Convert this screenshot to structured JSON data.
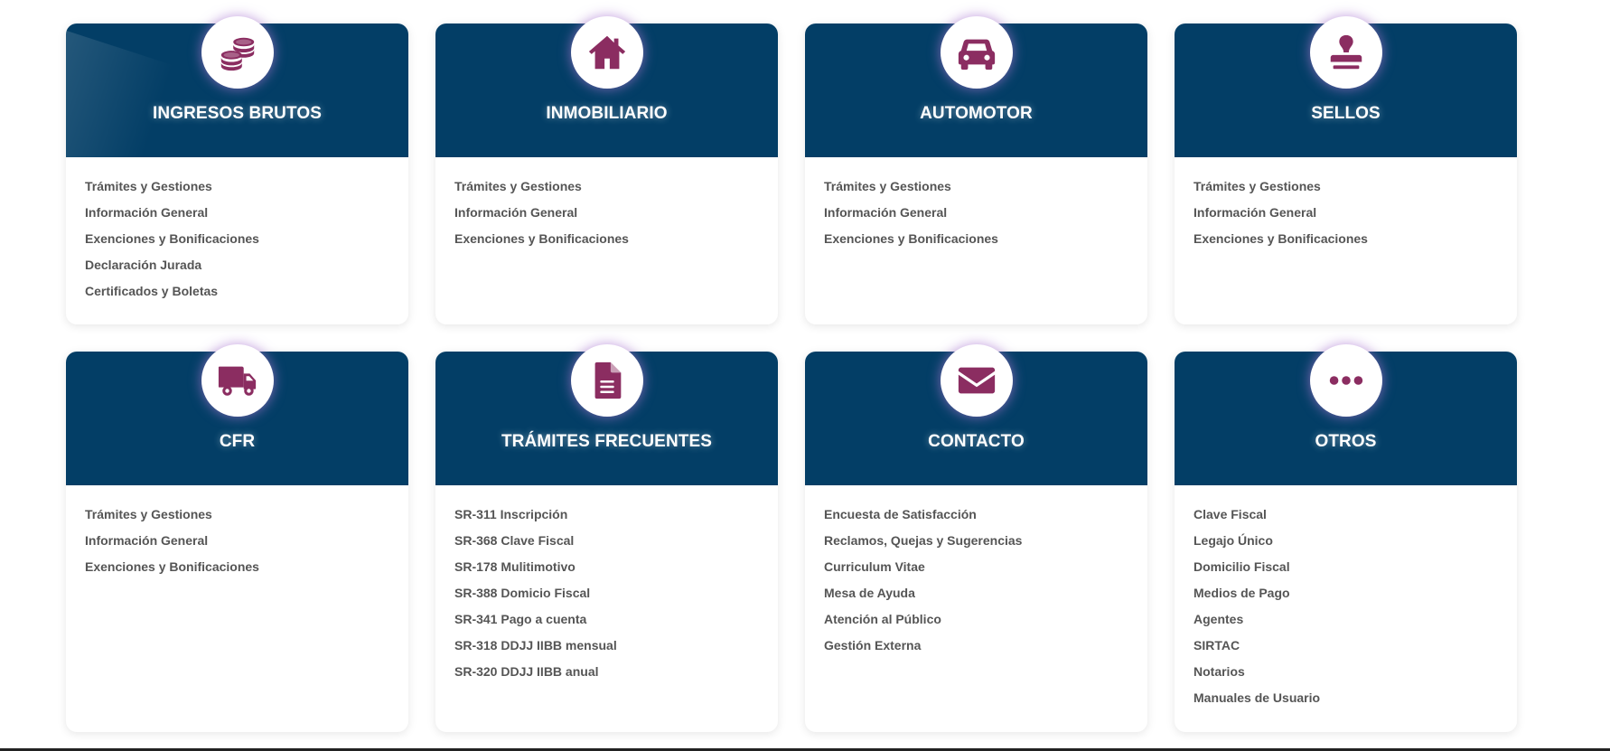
{
  "colors": {
    "header_bg": "#033e66",
    "icon_color": "#8b2d61",
    "link_color": "#555555",
    "icon_glow": "#b27cd6"
  },
  "cards": [
    {
      "title": "INGRESOS BRUTOS",
      "icon": "coins-stack-icon",
      "links": [
        "Trámites y Gestiones",
        "Información General",
        "Exenciones y Bonificaciones",
        "Declaración Jurada",
        "Certificados y Boletas"
      ]
    },
    {
      "title": "INMOBILIARIO",
      "icon": "house-icon",
      "links": [
        "Trámites y Gestiones",
        "Información General",
        "Exenciones y Bonificaciones"
      ]
    },
    {
      "title": "AUTOMOTOR",
      "icon": "car-icon",
      "links": [
        "Trámites y Gestiones",
        "Información General",
        "Exenciones y Bonificaciones"
      ]
    },
    {
      "title": "SELLOS",
      "icon": "stamp-icon",
      "links": [
        "Trámites y Gestiones",
        "Información General",
        "Exenciones y Bonificaciones"
      ]
    },
    {
      "title": "CFR",
      "icon": "truck-icon",
      "links": [
        "Trámites y Gestiones",
        "Información General",
        "Exenciones y Bonificaciones"
      ]
    },
    {
      "title": "TRÁMITES FRECUENTES",
      "icon": "document-icon",
      "links": [
        "SR-311 Inscripción",
        "SR-368 Clave Fiscal",
        "SR-178 Mulitimotivo",
        "SR-388 Domicio Fiscal",
        "SR-341 Pago a cuenta",
        "SR-318 DDJJ IIBB mensual",
        "SR-320 DDJJ IIBB anual"
      ]
    },
    {
      "title": "CONTACTO",
      "icon": "envelope-icon",
      "links": [
        "Encuesta de Satisfacción",
        "Reclamos, Quejas y Sugerencias",
        "Curriculum Vitae",
        "Mesa de Ayuda",
        "Atención al Público",
        "Gestión Externa"
      ]
    },
    {
      "title": "OTROS",
      "icon": "ellipsis-icon",
      "links": [
        "Clave Fiscal",
        "Legajo Único",
        "Domicilio Fiscal",
        "Medios de Pago",
        "Agentes",
        "SIRTAC",
        "Notarios",
        "Manuales de Usuario"
      ]
    }
  ]
}
